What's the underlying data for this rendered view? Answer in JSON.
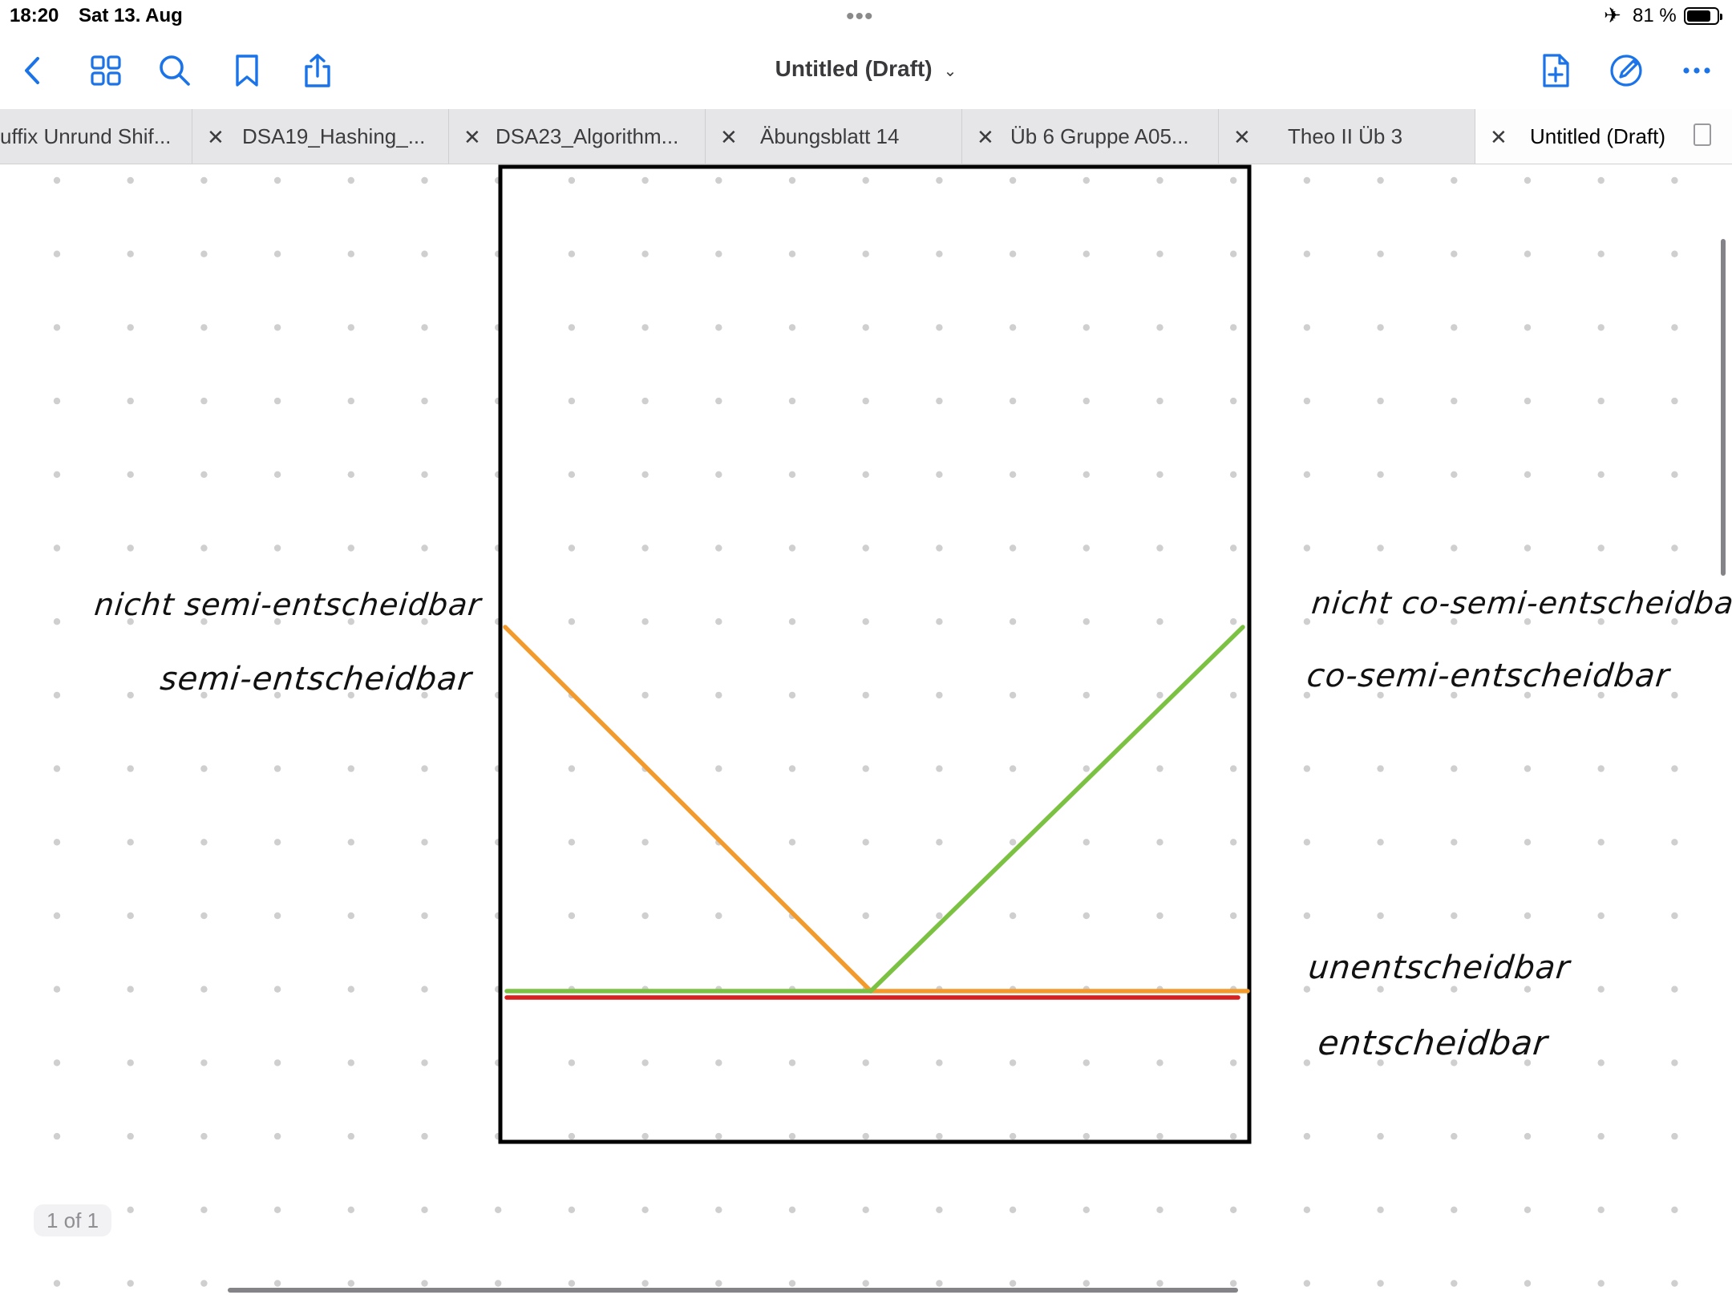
{
  "status_bar": {
    "time": "18:20",
    "date": "Sat 13. Aug",
    "battery_percent": "81 %",
    "battery_level": 0.81
  },
  "toolbar": {
    "title": "Untitled (Draft)",
    "accent_color": "#1a73e8",
    "icons_left": [
      "back-icon",
      "grid-icon",
      "search-icon",
      "bookmark-icon",
      "share-icon"
    ],
    "icons_right": [
      "add-page-icon",
      "markup-pen-icon",
      "more-icon"
    ]
  },
  "tabs": [
    {
      "label": "uffix Unrund Shif..."
    },
    {
      "label": "DSA19_Hashing_..."
    },
    {
      "label": "DSA23_Algorithm..."
    },
    {
      "label": "Äbungsblatt 14"
    },
    {
      "label": "Üb 6 Gruppe A05..."
    },
    {
      "label": "Theo II Üb 3"
    },
    {
      "label": "Untitled (Draft)",
      "active": true
    }
  ],
  "handwriting": {
    "left_top": "nicht semi-entscheidbar",
    "left_bottom": "semi-entscheidbar",
    "right_top": "nicht co-semi-entscheidbar",
    "right_middle": "co-semi-entscheidbar",
    "right_lower": "unentscheidbar",
    "right_bottom": "entscheidbar"
  },
  "drawing_colors": {
    "frame": "#000000",
    "orange": "#f39a2d",
    "green": "#7cc242",
    "red": "#d62020"
  },
  "page_indicator": "1 of 1"
}
